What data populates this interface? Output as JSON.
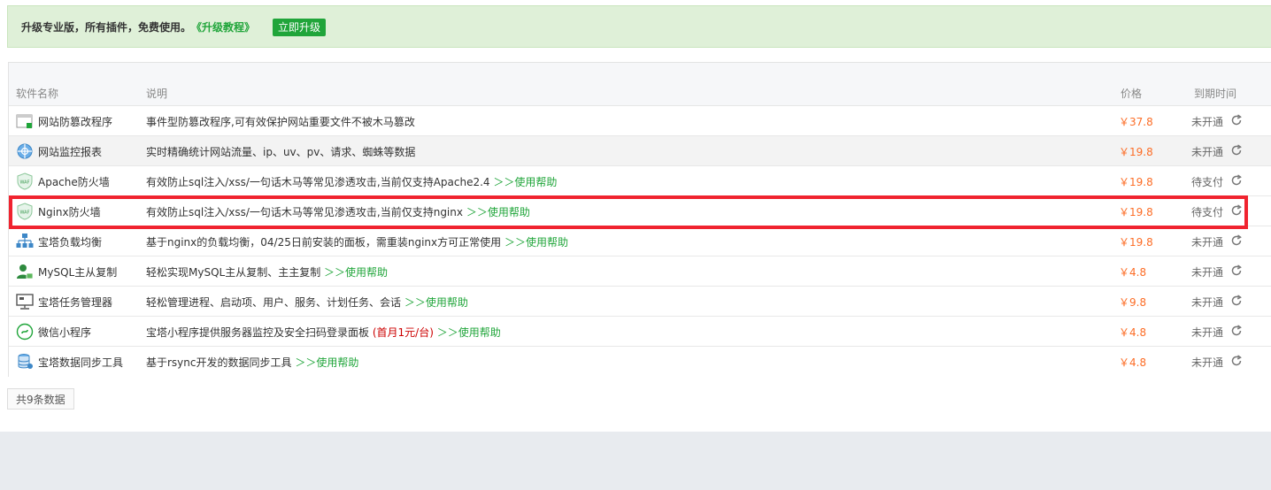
{
  "banner": {
    "message": "升级专业版，所有插件，免费使用。",
    "tutorial_link": "《升级教程》",
    "upgrade_button": "立即升级"
  },
  "table": {
    "headers": {
      "name": "软件名称",
      "description": "说明",
      "price": "价格",
      "expiry": "到期时间"
    },
    "rows": [
      {
        "name": "网站防篡改程序",
        "desc": "事件型防篡改程序,可有效保护网站重要文件不被木马篡改",
        "help": "",
        "price": "￥37.8",
        "status": "未开通",
        "icon": "anti-tamper-icon"
      },
      {
        "name": "网站监控报表",
        "desc": "实时精确统计网站流量、ip、uv、pv、请求、蜘蛛等数据",
        "help": "",
        "price": "￥19.8",
        "status": "未开通",
        "icon": "monitor-report-icon"
      },
      {
        "name": "Apache防火墙",
        "desc": "有效防止sql注入/xss/一句话木马等常见渗透攻击,当前仅支持Apache2.4",
        "help": "＞＞使用帮助",
        "price": "￥19.8",
        "status": "待支付",
        "icon": "waf-shield-icon"
      },
      {
        "name": "Nginx防火墙",
        "desc": "有效防止sql注入/xss/一句话木马等常见渗透攻击,当前仅支持nginx",
        "help": "＞＞使用帮助",
        "price": "￥19.8",
        "status": "待支付",
        "icon": "waf-shield-icon"
      },
      {
        "name": "宝塔负载均衡",
        "desc": "基于nginx的负载均衡，04/25日前安装的面板，需重装nginx方可正常使用",
        "help": "＞＞使用帮助",
        "price": "￥19.8",
        "status": "未开通",
        "icon": "load-balance-icon"
      },
      {
        "name": "MySQL主从复制",
        "desc": "轻松实现MySQL主从复制、主主复制",
        "help": "＞＞使用帮助",
        "price": "￥4.8",
        "status": "未开通",
        "icon": "mysql-replication-icon"
      },
      {
        "name": "宝塔任务管理器",
        "desc": "轻松管理进程、启动项、用户、服务、计划任务、会话",
        "help": "＞＞使用帮助",
        "price": "￥9.8",
        "status": "未开通",
        "icon": "task-manager-icon"
      },
      {
        "name": "微信小程序",
        "desc": "宝塔小程序提供服务器监控及安全扫码登录面板",
        "desc_red": "(首月1元/台)",
        "help": "＞＞使用帮助",
        "price": "￥4.8",
        "status": "未开通",
        "icon": "wechat-miniapp-icon"
      },
      {
        "name": "宝塔数据同步工具",
        "desc": "基于rsync开发的数据同步工具",
        "help": "＞＞使用帮助",
        "price": "￥4.8",
        "status": "未开通",
        "icon": "data-sync-icon"
      }
    ]
  },
  "footer": {
    "total": "共9条数据"
  },
  "colors": {
    "accent": "#20a53a",
    "price": "#fc6d26",
    "highlight_border": "#f0232f"
  }
}
